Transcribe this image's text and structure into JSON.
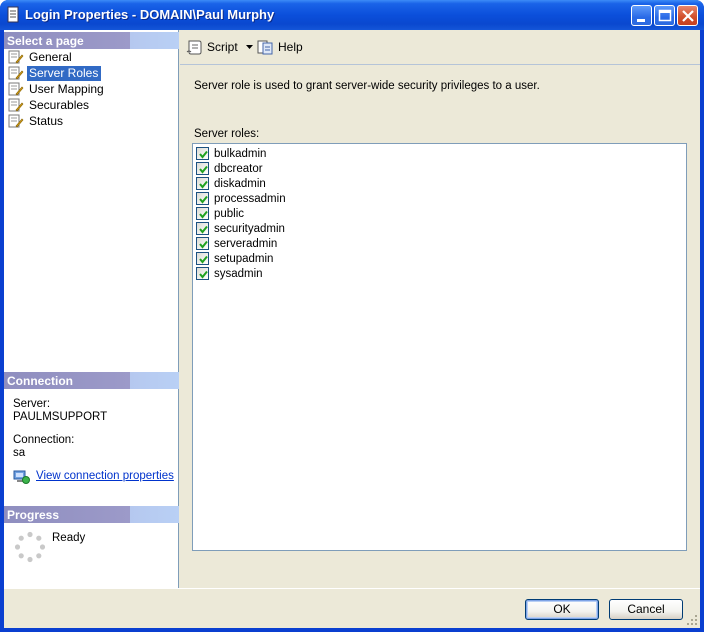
{
  "window": {
    "title": "Login Properties - DOMAIN\\Paul Murphy"
  },
  "left": {
    "select_page_header": "Select a page",
    "pages": [
      {
        "label": "General",
        "selected": false
      },
      {
        "label": "Server Roles",
        "selected": true
      },
      {
        "label": "User Mapping",
        "selected": false
      },
      {
        "label": "Securables",
        "selected": false
      },
      {
        "label": "Status",
        "selected": false
      }
    ],
    "connection_header": "Connection",
    "server_label": "Server:",
    "server_value": "PAULMSUPPORT",
    "connection_label": "Connection:",
    "connection_value": "sa",
    "view_link": "View connection properties",
    "progress_header": "Progress",
    "progress_status": "Ready"
  },
  "toolbar": {
    "script_label": "Script",
    "help_label": "Help"
  },
  "content": {
    "description": "Server role is used to grant server-wide security privileges to a user.",
    "roles_label": "Server roles:",
    "roles": [
      {
        "name": "bulkadmin",
        "checked": true
      },
      {
        "name": "dbcreator",
        "checked": true
      },
      {
        "name": "diskadmin",
        "checked": true
      },
      {
        "name": "processadmin",
        "checked": true
      },
      {
        "name": "public",
        "checked": true
      },
      {
        "name": "securityadmin",
        "checked": true
      },
      {
        "name": "serveradmin",
        "checked": true
      },
      {
        "name": "setupadmin",
        "checked": true
      },
      {
        "name": "sysadmin",
        "checked": true
      }
    ]
  },
  "buttons": {
    "ok": "OK",
    "cancel": "Cancel"
  },
  "colors": {
    "title_bar": "#0a48cf",
    "selection": "#316ac5",
    "check": "#21a121",
    "link": "#0033cc"
  }
}
